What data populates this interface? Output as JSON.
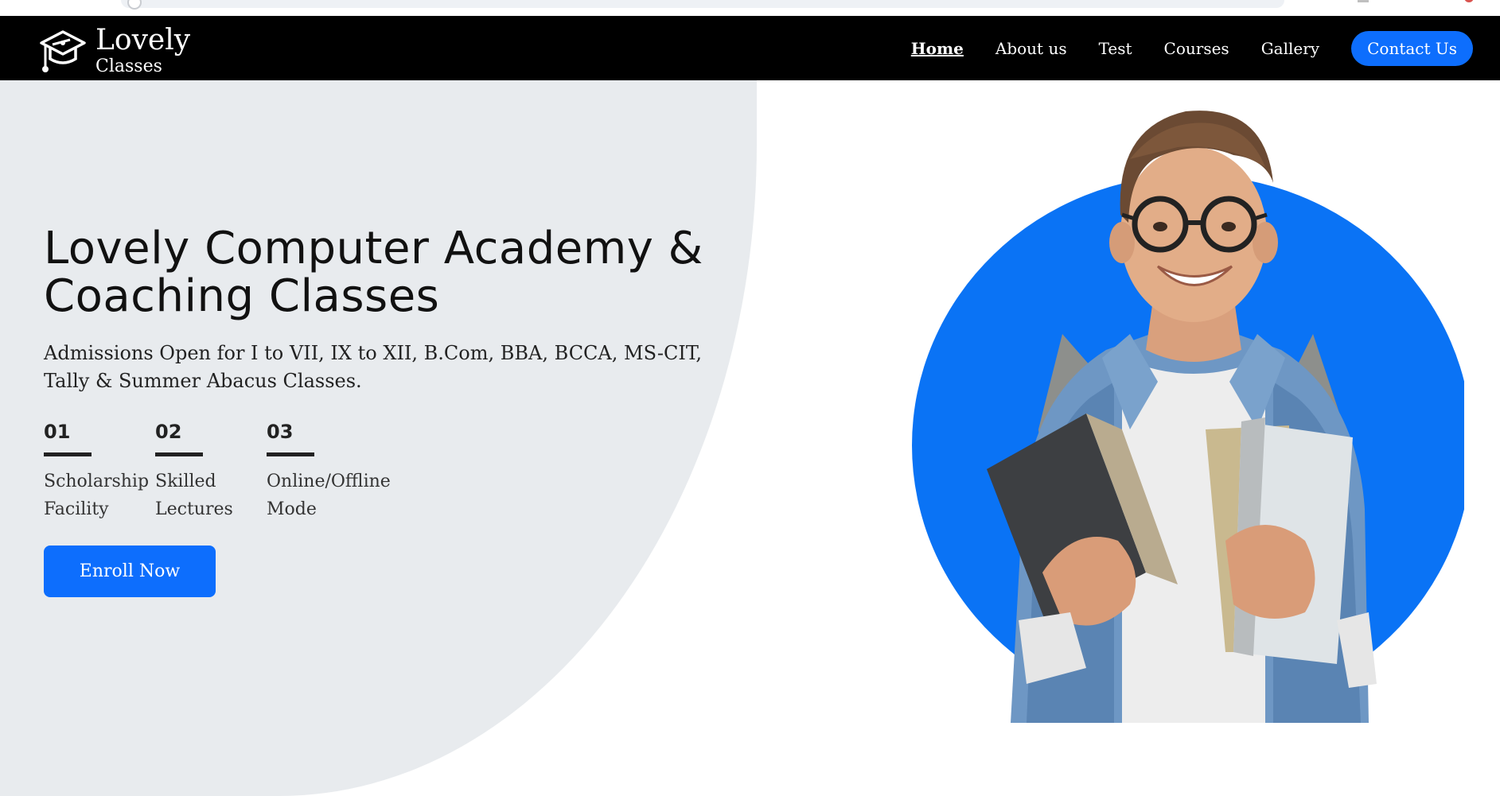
{
  "brand": {
    "name": "Lovely",
    "subtitle": "Classes"
  },
  "nav": {
    "items": [
      {
        "label": "Home",
        "active": true
      },
      {
        "label": "About us",
        "active": false
      },
      {
        "label": "Test",
        "active": false
      },
      {
        "label": "Courses",
        "active": false
      },
      {
        "label": "Gallery",
        "active": false
      }
    ],
    "contact_label": "Contact Us"
  },
  "hero": {
    "title": "Lovely Computer Academy & Coaching Classes",
    "subtitle": "Admissions Open for I to VII, IX to XII, B.Com, BBA, BCCA, MS-CIT, Tally & Summer Abacus Classes.",
    "features": [
      {
        "number": "01",
        "label": "Scholarship Facility"
      },
      {
        "number": "02",
        "label": "Skilled Lectures"
      },
      {
        "number": "03",
        "label": "Online/Offline Mode"
      }
    ],
    "enroll_label": "Enroll Now",
    "image_description": "smiling student with glasses holding books"
  },
  "colors": {
    "navbar": "#000000",
    "accent": "#0d6efd",
    "hero_left_bg": "#e8ebee"
  },
  "icons": {
    "brand": "graduation-cap-icon"
  }
}
